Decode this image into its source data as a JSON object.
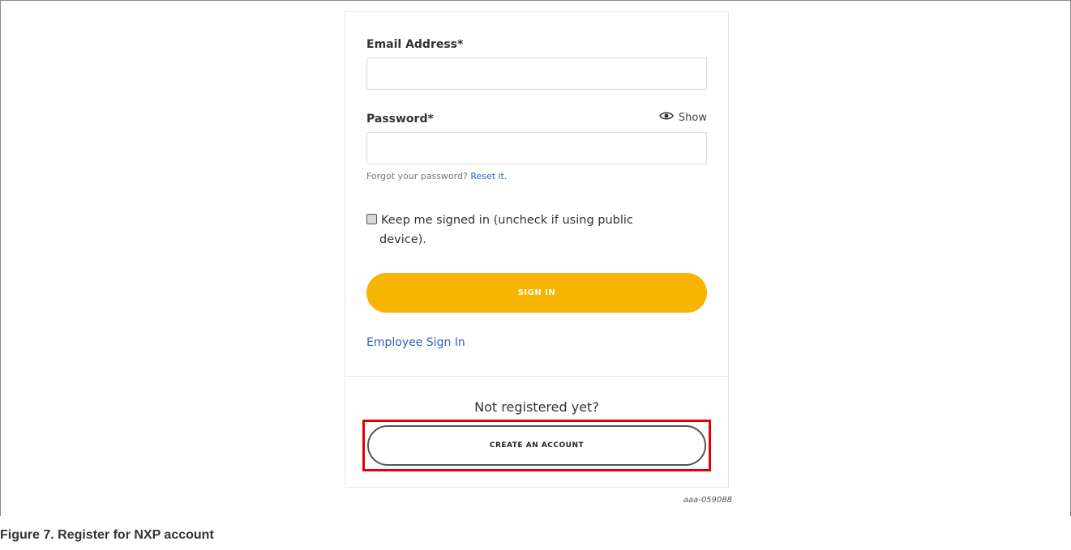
{
  "form": {
    "email_label": "Email Address*",
    "email_value": "",
    "password_label": "Password*",
    "password_value": "",
    "show_label": "Show",
    "show_icon": "eye-icon",
    "forgot_text": "Forgot your password?",
    "reset_link": "Reset it.",
    "keep_signed_in_line1": "Keep me signed in (uncheck if using public",
    "keep_signed_in_line2": "device).",
    "sign_in_label": "SIGN IN",
    "employee_sign_in": "Employee Sign In"
  },
  "register": {
    "prompt": "Not registered yet?",
    "create_label": "CREATE AN ACCOUNT"
  },
  "figure": {
    "code": "aaa-059088",
    "caption": "Figure 7.  Register for NXP account"
  },
  "colors": {
    "accent": "#f7b400",
    "link": "#2e63b8",
    "highlight": "#e00000"
  }
}
